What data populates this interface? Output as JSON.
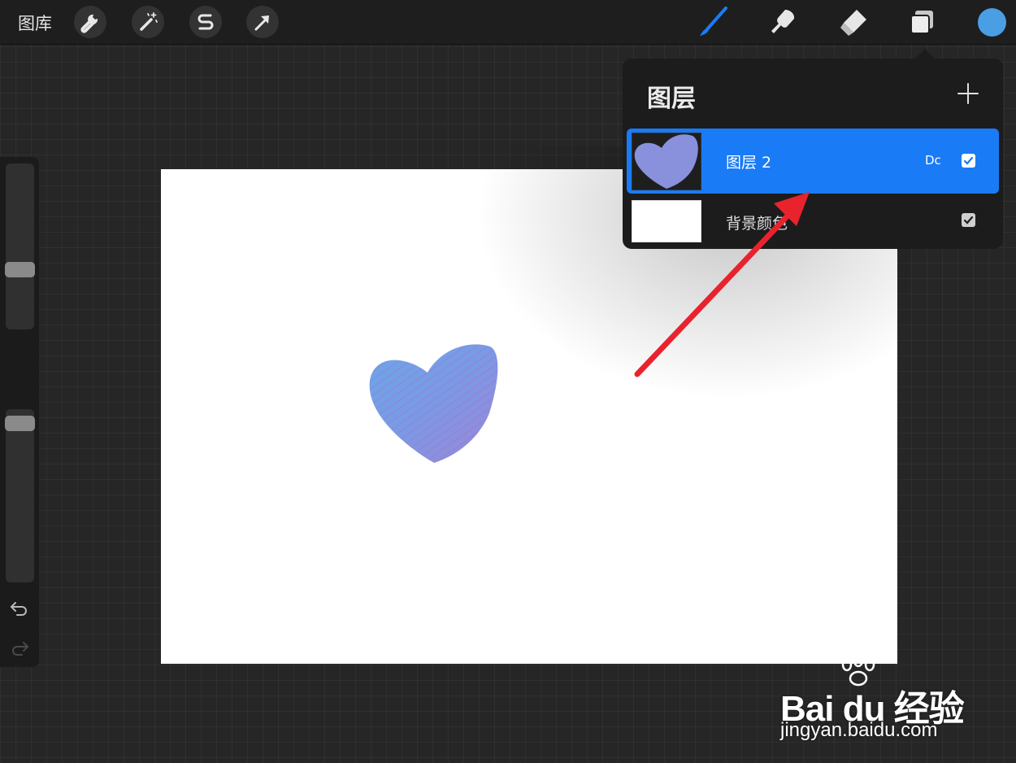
{
  "topbar": {
    "gallery_label": "图库",
    "left_tools": [
      {
        "icon": "wrench-icon",
        "name": "actions"
      },
      {
        "icon": "magic-wand-icon",
        "name": "adjustments"
      },
      {
        "icon": "selection-s-icon",
        "name": "selection"
      },
      {
        "icon": "arrow-cursor-icon",
        "name": "transform"
      }
    ],
    "right_tools": [
      {
        "icon": "brush-icon",
        "name": "paint",
        "active": true
      },
      {
        "icon": "smudge-icon",
        "name": "smudge"
      },
      {
        "icon": "eraser-icon",
        "name": "eraser"
      },
      {
        "icon": "layers-icon",
        "name": "layers"
      }
    ],
    "current_color": "#4a9ee4",
    "active_tool_color": "#1a7bf6"
  },
  "sidebar": {
    "brush_size_level": 0.64,
    "opacity_level": 0.97,
    "undo_icon": "undo-icon",
    "redo_icon": "redo-icon"
  },
  "layers_panel": {
    "title": "图层",
    "add_icon": "plus-icon",
    "layers": [
      {
        "name": "图层 2",
        "blend_mode": "Dc",
        "visible": true,
        "selected": true,
        "thumbnail": "heart"
      },
      {
        "name": "背景颜色",
        "visible": true,
        "selected": false,
        "thumbnail": "white"
      }
    ]
  },
  "annotation": {
    "arrow_color": "#e8232e"
  },
  "watermark": {
    "brand": "Bai du 经验",
    "url": "jingyan.baidu.com"
  }
}
